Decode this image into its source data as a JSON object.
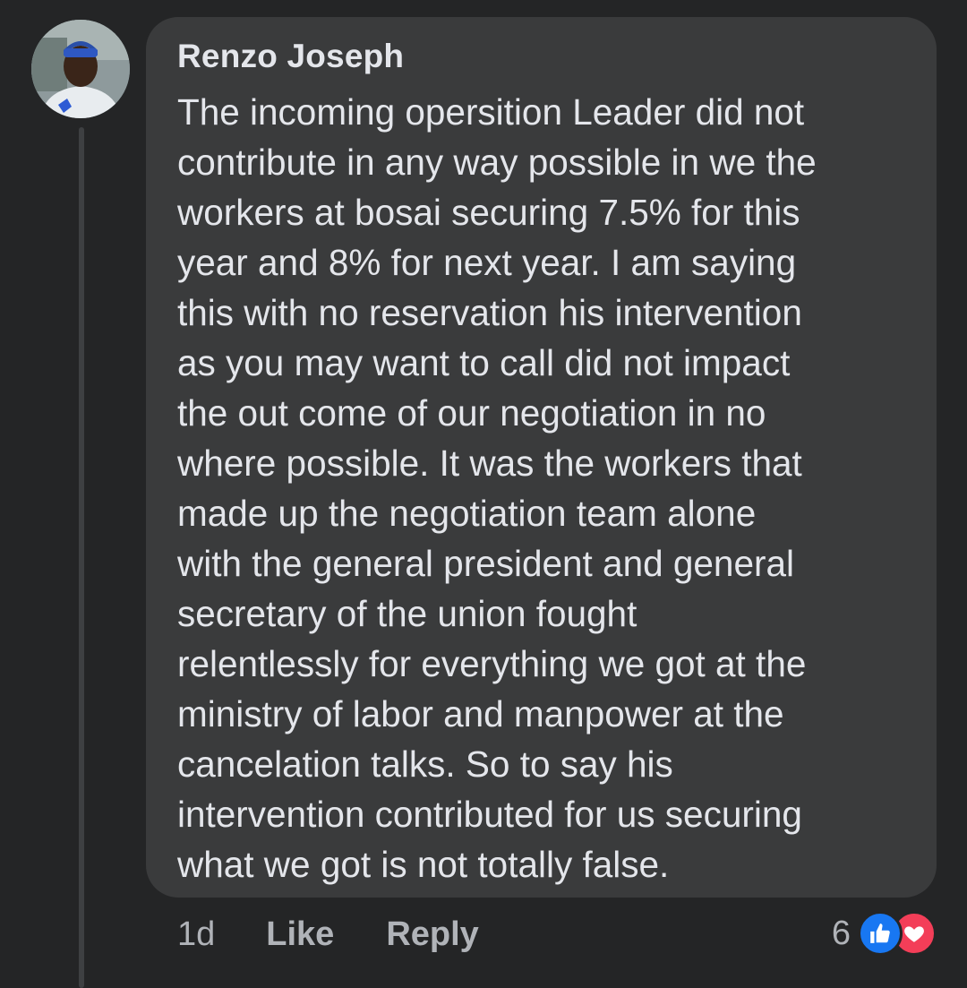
{
  "comment": {
    "author": "Renzo Joseph",
    "lines": [
      "The incoming opersition Leader did not",
      "contribute in any way possible in we the",
      "workers at bosai securing 7.5% for this",
      "year and 8% for next year. I am saying",
      "this with no reservation his intervention",
      "as you may want to call did not impact",
      "the out come of our negotiation in no",
      "where possible. It was the workers that",
      "made up the negotiation team alone",
      "with the general president and general",
      "secretary of the union fought",
      "relentlessly for everything we got at the",
      "ministry of labor and manpower at the",
      "cancelation talks. So to say his",
      "intervention contributed for us securing",
      "what we got is not totally false."
    ]
  },
  "actions": {
    "time": "1d",
    "like_label": "Like",
    "reply_label": "Reply"
  },
  "reactions": {
    "count": "6",
    "icons": [
      "thumbs-up-icon",
      "heart-icon"
    ]
  },
  "colors": {
    "background": "#242526",
    "bubble": "#3a3b3c",
    "text": "#e4e6eb",
    "secondary_text": "#b0b3b8",
    "like_blue": "#1877f2",
    "love_red": "#f33e58"
  }
}
